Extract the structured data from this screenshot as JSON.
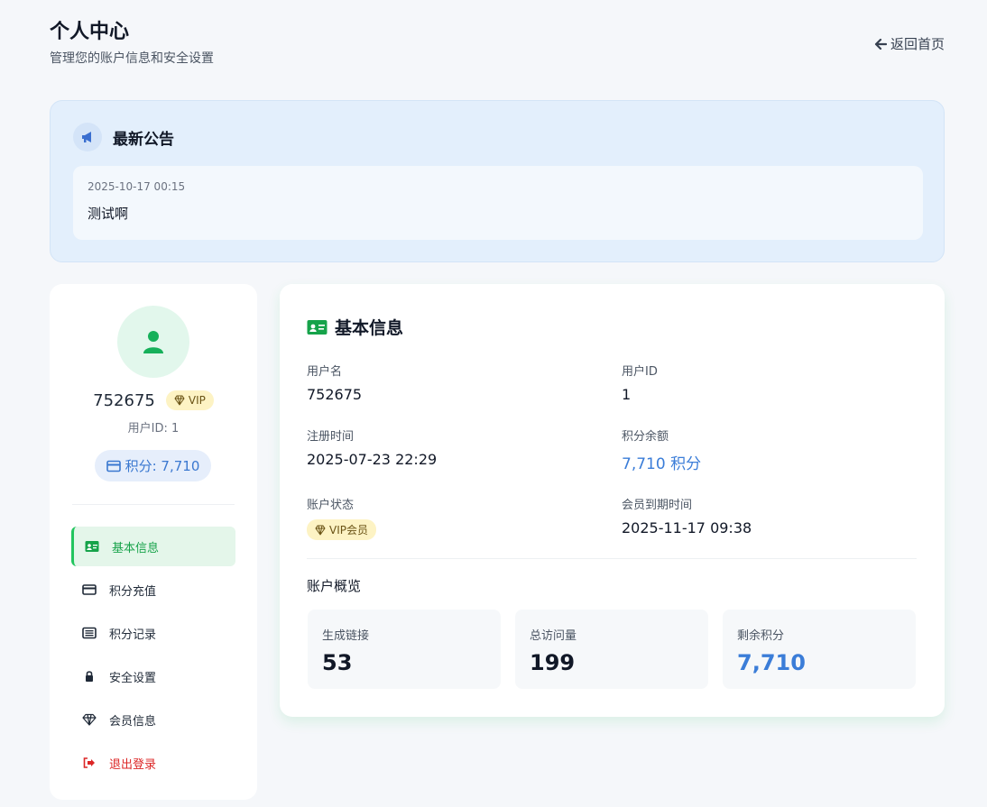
{
  "header": {
    "title": "个人中心",
    "subtitle": "管理您的账户信息和安全设置",
    "back_label": "返回首页"
  },
  "announcement": {
    "title": "最新公告",
    "items": [
      {
        "date": "2025-10-17 00:15",
        "text": "测试啊"
      }
    ]
  },
  "profile": {
    "username": "752675",
    "vip_label": "VIP",
    "user_id_text": "用户ID: 1",
    "points_text": "积分: 7,710"
  },
  "menu": [
    {
      "label": "基本信息",
      "icon": "id-card-icon",
      "active": true
    },
    {
      "label": "积分充值",
      "icon": "credit-card-icon",
      "active": false
    },
    {
      "label": "积分记录",
      "icon": "list-icon",
      "active": false
    },
    {
      "label": "安全设置",
      "icon": "lock-icon",
      "active": false
    },
    {
      "label": "会员信息",
      "icon": "diamond-icon",
      "active": false
    },
    {
      "label": "退出登录",
      "icon": "logout-icon",
      "active": false
    }
  ],
  "basic_info": {
    "title": "基本信息",
    "username_label": "用户名",
    "username_value": "752675",
    "userid_label": "用户ID",
    "userid_value": "1",
    "register_label": "注册时间",
    "register_value": "2025-07-23 22:29",
    "points_label": "积分余额",
    "points_value": "7,710 积分",
    "status_label": "账户状态",
    "status_value": "VIP会员",
    "expire_label": "会员到期时间",
    "expire_value": "2025-11-17 09:38"
  },
  "overview": {
    "title": "账户概览",
    "stats": [
      {
        "label": "生成链接",
        "value": "53"
      },
      {
        "label": "总访问量",
        "value": "199"
      },
      {
        "label": "剩余积分",
        "value": "7,710"
      }
    ]
  },
  "colors": {
    "accent_green": "#22c55e",
    "accent_blue": "#3b7dd8",
    "danger_red": "#dc2626",
    "vip_yellow": "#fdf3c4"
  }
}
